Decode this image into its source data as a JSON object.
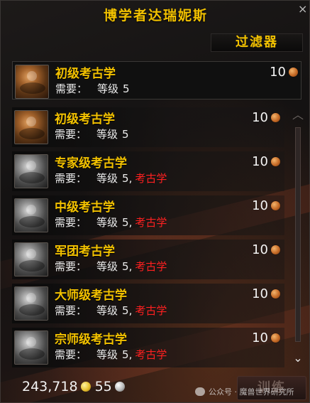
{
  "window": {
    "title": "博学者达瑞妮斯",
    "close_glyph": "×"
  },
  "filter": {
    "label": "过滤器"
  },
  "featured": {
    "name": "初级考古学",
    "req_label": "需要：",
    "level_label": "等级",
    "level": "5",
    "cost": "10",
    "icon": "archaeology-icon"
  },
  "recipes": [
    {
      "name": "初级考古学",
      "req_label": "需要：",
      "level_label": "等级",
      "level": "5",
      "sep": "",
      "missing": "",
      "cost": "10",
      "tint": "color"
    },
    {
      "name": "专家级考古学",
      "req_label": "需要：",
      "level_label": "等级",
      "level": "5",
      "sep": ",",
      "missing": "考古学",
      "cost": "10",
      "tint": "gray"
    },
    {
      "name": "中级考古学",
      "req_label": "需要：",
      "level_label": "等级",
      "level": "5",
      "sep": ",",
      "missing": "考古学",
      "cost": "10",
      "tint": "gray"
    },
    {
      "name": "军团考古学",
      "req_label": "需要：",
      "level_label": "等级",
      "level": "5",
      "sep": ",",
      "missing": "考古学",
      "cost": "10",
      "tint": "gray"
    },
    {
      "name": "大师级考古学",
      "req_label": "需要：",
      "level_label": "等级",
      "level": "5",
      "sep": ",",
      "missing": "考古学",
      "cost": "10",
      "tint": "gray"
    },
    {
      "name": "宗师级考古学",
      "req_label": "需要：",
      "level_label": "等级",
      "level": "5",
      "sep": ",",
      "missing": "考古学",
      "cost": "10",
      "tint": "gray"
    }
  ],
  "scrollbar": {
    "up_glyph": "︿",
    "down_glyph": "⌄"
  },
  "money": {
    "gold": "243,718",
    "silver": "55"
  },
  "train": {
    "label": "训练"
  },
  "watermark": {
    "text": "公众号 · 魔兽世界研究所"
  },
  "colors": {
    "title_gold": "#f2c100",
    "requirement_missing": "#ff2020",
    "copper_coin": "#c56a26"
  }
}
